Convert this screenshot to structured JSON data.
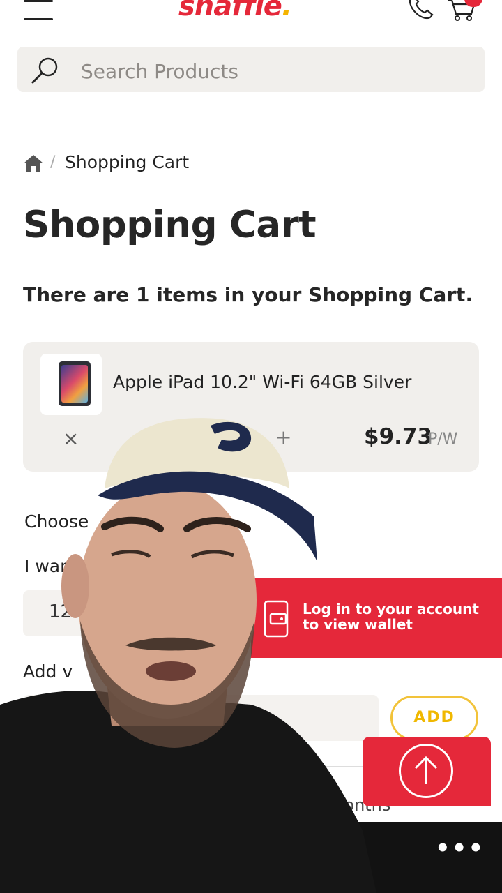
{
  "header": {
    "logo_text": "snaffle",
    "logo_dot": ".",
    "menu_icon": "hamburger-menu-icon",
    "phone_icon": "phone-icon",
    "cart_icon": "shopping-cart-icon"
  },
  "search": {
    "placeholder": "Search Products",
    "icon": "search-icon"
  },
  "breadcrumb": {
    "home_icon": "home-icon",
    "separator": "/",
    "current": "Shopping Cart"
  },
  "page": {
    "title": "Shopping Cart",
    "cart_summary": "There are 1 items in your Shopping Cart."
  },
  "cart_item": {
    "name": "Apple iPad 10.2\" Wi-Fi 64GB Silver",
    "remove_glyph": "×",
    "increment_glyph": "+",
    "price": "$9.73",
    "price_unit": "P/W"
  },
  "options": {
    "choose_label": "Choose",
    "want_label": "I wan",
    "term_value": "12",
    "add_voucher_label": "Add v",
    "add_button": "ADD",
    "months_text": "months"
  },
  "wallet_banner": {
    "line1": "Log in to your account",
    "line2": "to view wallet",
    "icon": "wallet-icon"
  },
  "scroll_top": {
    "icon": "arrow-up-icon"
  },
  "bottom_bar": {
    "more": "•••"
  },
  "colors": {
    "brand_red": "#e5283a",
    "accent_yellow": "#f2c33a",
    "card_bg": "#f1efec"
  }
}
